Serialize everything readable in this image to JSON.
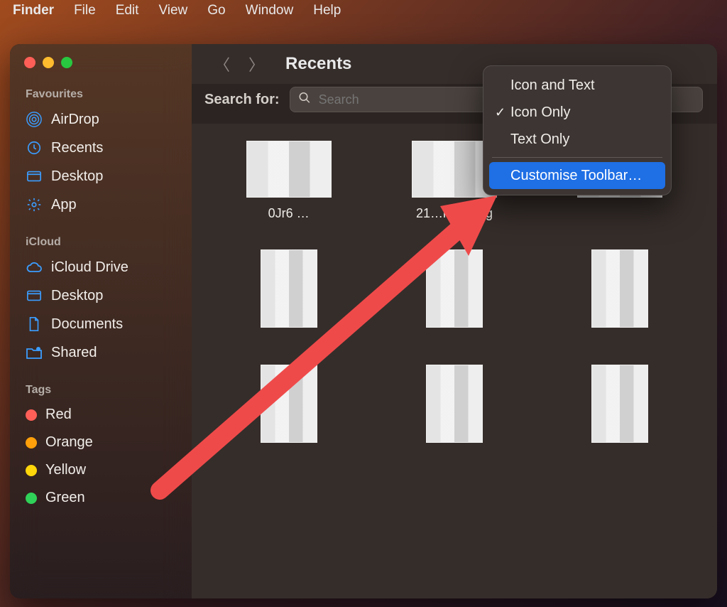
{
  "menubar": {
    "app": "Finder",
    "items": [
      "File",
      "Edit",
      "View",
      "Go",
      "Window",
      "Help"
    ]
  },
  "window": {
    "title": "Recents"
  },
  "sidebar": {
    "groups": [
      {
        "label": "Favourites",
        "items": [
          {
            "icon": "airdrop",
            "label": "AirDrop"
          },
          {
            "icon": "clock",
            "label": "Recents"
          },
          {
            "icon": "desktop",
            "label": "Desktop"
          },
          {
            "icon": "gear",
            "label": "App"
          }
        ]
      },
      {
        "label": "iCloud",
        "items": [
          {
            "icon": "cloud",
            "label": "iCloud Drive"
          },
          {
            "icon": "desktop",
            "label": "Desktop"
          },
          {
            "icon": "document",
            "label": "Documents"
          },
          {
            "icon": "folder-shared",
            "label": "Shared"
          }
        ]
      },
      {
        "label": "Tags",
        "items": [
          {
            "icon": "tag",
            "color": "#ff5f57",
            "label": "Red"
          },
          {
            "icon": "tag",
            "color": "#ff9f0a",
            "label": "Orange"
          },
          {
            "icon": "tag",
            "color": "#ffd60a",
            "label": "Yellow"
          },
          {
            "icon": "tag",
            "color": "#30d158",
            "label": "Green"
          }
        ]
      }
    ]
  },
  "search": {
    "label": "Search for:",
    "placeholder": "Search"
  },
  "files": [
    {
      "name": "0Jr6 …"
    },
    {
      "name": "21…ic_….jpg"
    },
    {
      "name": ""
    },
    {
      "name": ""
    },
    {
      "name": ""
    },
    {
      "name": ""
    },
    {
      "name": ""
    },
    {
      "name": ""
    },
    {
      "name": ""
    }
  ],
  "context_menu": {
    "items": [
      {
        "label": "Icon and Text",
        "checked": false
      },
      {
        "label": "Icon Only",
        "checked": true
      },
      {
        "label": "Text Only",
        "checked": false
      }
    ],
    "separator_after": 2,
    "highlighted": "Customise Toolbar…"
  },
  "icons": {
    "airdrop": "◎",
    "clock": "◷",
    "desktop": "▭",
    "gear": "⚙",
    "cloud": "☁",
    "document": "🗎",
    "folder-shared": "🗂",
    "mag": "🔍",
    "check": "✓",
    "chevron_left": "〈",
    "chevron_right": "〉"
  }
}
